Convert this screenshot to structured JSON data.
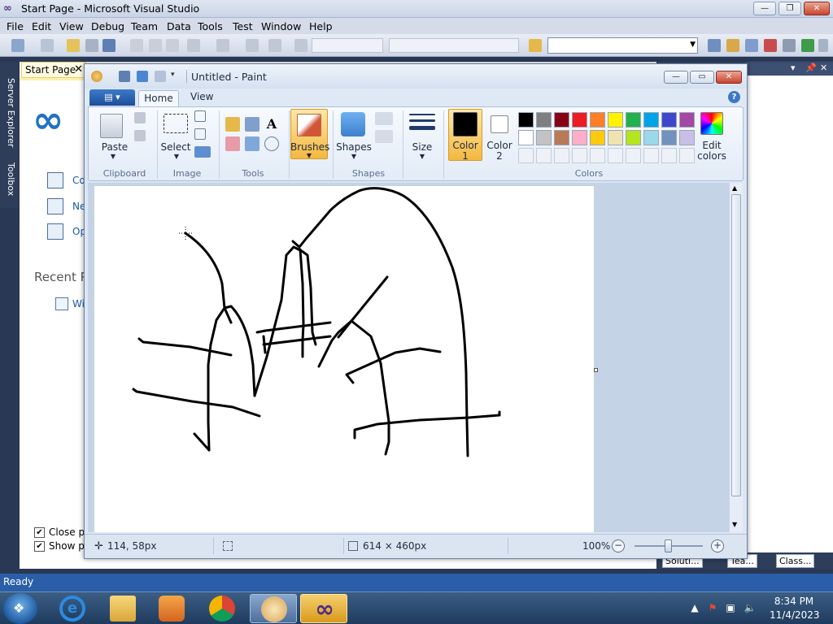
{
  "vs": {
    "title": "Start Page - Microsoft Visual Studio",
    "menu": [
      "File",
      "Edit",
      "View",
      "Debug",
      "Team",
      "Data",
      "Tools",
      "Test",
      "Window",
      "Help"
    ],
    "side_tabs": [
      "Server Explorer",
      "Toolbox"
    ],
    "doc_tab": "Start Page",
    "links": [
      "Co",
      "Ne",
      "Op"
    ],
    "recent_heading": "Recent P",
    "recent_item": "Wi",
    "checkboxes": [
      {
        "label": "Close pa",
        "checked": true
      },
      {
        "label": "Show pa",
        "checked": true
      }
    ],
    "bottom_tabs": [
      "Soluti...",
      "Tea...",
      "Class..."
    ],
    "status": "Ready"
  },
  "paint": {
    "title": "Untitled - Paint",
    "tabs": {
      "home": "Home",
      "view": "View"
    },
    "groups": {
      "clipboard": "Clipboard",
      "image": "Image",
      "tools": "Tools",
      "shapes": "Shapes",
      "colors": "Colors"
    },
    "buttons": {
      "paste": "Paste",
      "select": "Select",
      "brushes": "Brushes",
      "shapes": "Shapes",
      "size": "Size",
      "color1": "Color",
      "color1_num": "1",
      "color2": "Color",
      "color2_num": "2",
      "edit_colors_1": "Edit",
      "edit_colors_2": "colors"
    },
    "palette_row1": [
      "#000000",
      "#7f7f7f",
      "#880015",
      "#ed1c24",
      "#ff7f27",
      "#fff200",
      "#22b14c",
      "#00a2e8",
      "#3f48cc",
      "#a349a4"
    ],
    "palette_row2": [
      "#ffffff",
      "#c3c3c3",
      "#b97a57",
      "#ffaec9",
      "#ffc90e",
      "#efe4b0",
      "#b5e61d",
      "#99d9ea",
      "#7092be",
      "#c8bfe7"
    ],
    "color1_value": "#000000",
    "color2_value": "#ffffff",
    "status": {
      "cursor_pos": "114, 58px",
      "canvas_size": "614 × 460px",
      "zoom": "100%"
    }
  },
  "taskbar": {
    "time": "8:34 PM",
    "date": "11/4/2023"
  }
}
